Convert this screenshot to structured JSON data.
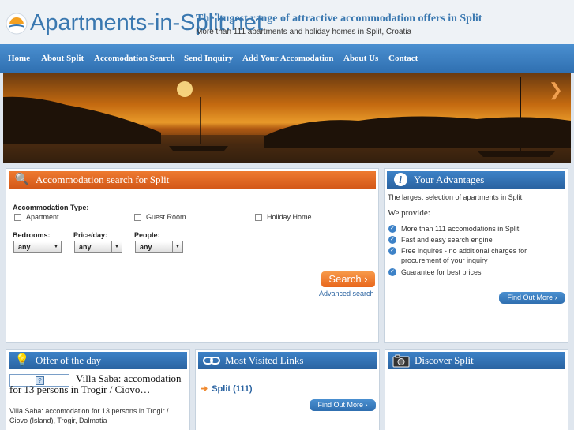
{
  "header": {
    "logo_text": "Apartments-in-Split.net",
    "tagline": "The hugest range of attractive accommodation offers in Split",
    "subtagline": "More than 111 apartments and holiday homes in Split, Croatia"
  },
  "nav": {
    "items": [
      {
        "label": "Home"
      },
      {
        "label": "About Split"
      },
      {
        "label": "Accomodation Search"
      },
      {
        "label": "Send Inquiry"
      },
      {
        "label": "Add Your Accomodation"
      },
      {
        "label": "About Us"
      },
      {
        "label": "Contact"
      }
    ]
  },
  "hero": {
    "next_arrow": "❯"
  },
  "search": {
    "title": "Accommodation search for Split",
    "type_label": "Accommodation Type:",
    "types": [
      "Apartment",
      "Guest Room",
      "Holiday Home"
    ],
    "bedrooms_label": "Bedrooms:",
    "price_label": "Price/day:",
    "people_label": "People:",
    "bedrooms_value": "any",
    "price_value": "any",
    "people_value": "any",
    "search_button": "Search ›",
    "advanced_link": "Advanced search"
  },
  "advantages": {
    "title": "Your Advantages",
    "intro": "The largest selection of apartments in Split.",
    "provide": "We provide:",
    "items": [
      "More than 111 accomodations in Split",
      "Fast and easy search engine",
      "Free inquires - no additional charges for procurement of your inquiry",
      "Guarantee for best prices"
    ],
    "button": "Find Out More ›"
  },
  "offer": {
    "title": "Offer of the day",
    "name": "Villa Saba: accomodation for 13 persons in Trogir / Ciovo…",
    "desc": "Villa Saba: accomodation for 13 persons in Trogir / Ciovo (Island), Trogir, Dalmatia"
  },
  "links": {
    "title": "Most Visited Links",
    "item": "Split (111)",
    "button": "Find Out More ›"
  },
  "discover": {
    "title": "Discover Split"
  },
  "colors": {
    "accent_blue": "#2f6fb0",
    "accent_orange": "#e8661c"
  }
}
